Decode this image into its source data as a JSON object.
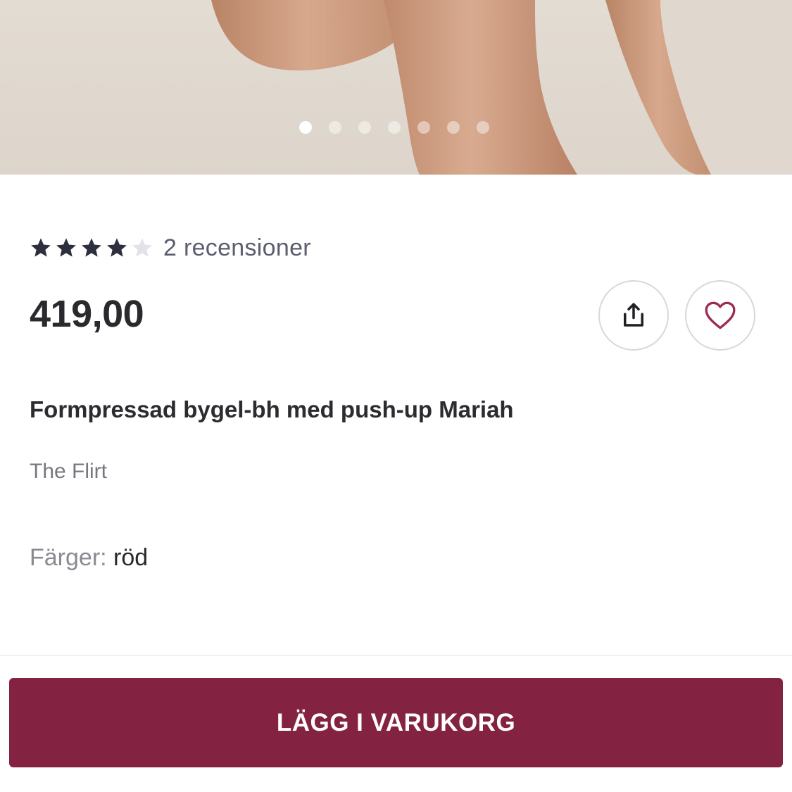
{
  "gallery": {
    "image_icon": "product-photo",
    "dot_count": 7,
    "active_index": 0
  },
  "rating": {
    "value": 4,
    "max": 5,
    "reviews_label": "2 recensioner"
  },
  "price": "419,00",
  "actions": {
    "share_icon": "share-icon",
    "favorite_icon": "heart-icon"
  },
  "product": {
    "title": "Formpressad bygel-bh med push-up Mariah",
    "brand": "The Flirt"
  },
  "colors": {
    "label": "Färger:",
    "value": "röd"
  },
  "cart": {
    "button_label": "LÄGG I VARUKORG"
  },
  "theme": {
    "accent": "#842242",
    "star_filled": "#2d2f3e",
    "star_empty": "#e2e3e8"
  }
}
